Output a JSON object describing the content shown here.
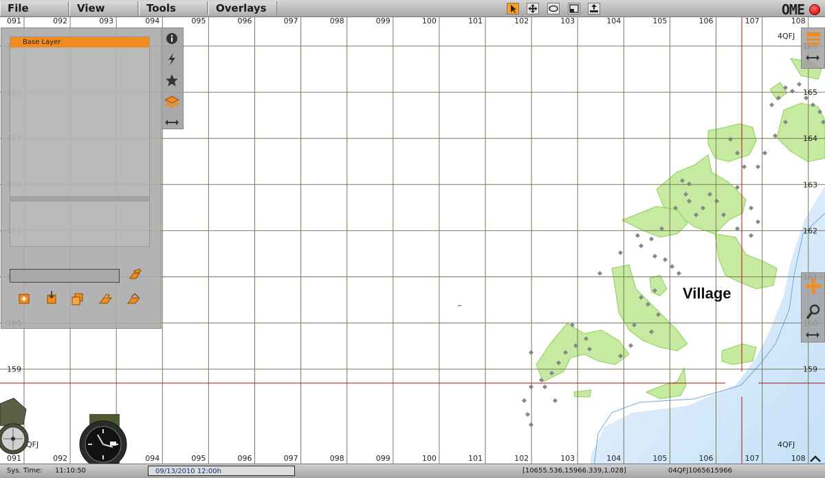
{
  "menu": {
    "items": [
      "File",
      "View",
      "Tools",
      "Overlays"
    ]
  },
  "toolbar": {
    "tools": [
      {
        "name": "pointer-tool",
        "icon": "cursor-arrow-icon",
        "active": true
      },
      {
        "name": "pan-tool",
        "icon": "move-arrows-icon",
        "active": false
      },
      {
        "name": "rotate-tool",
        "icon": "rotate-icon",
        "active": false
      },
      {
        "name": "zoom-box-tool",
        "icon": "zoom-box-icon",
        "active": false
      },
      {
        "name": "export-tool",
        "icon": "upload-icon",
        "active": false
      }
    ],
    "brand": "OME"
  },
  "grid": {
    "columns": [
      "091",
      "092",
      "093",
      "094",
      "095",
      "096",
      "097",
      "098",
      "099",
      "100",
      "101",
      "102",
      "103",
      "104",
      "105",
      "106",
      "107",
      "108"
    ],
    "rows": [
      "166",
      "165",
      "164",
      "163",
      "162",
      "161",
      "160",
      "159"
    ],
    "zone": "4QFJ"
  },
  "map": {
    "place_label": "Village"
  },
  "layers_panel": {
    "header": "Base Layer"
  },
  "side_tabs": [
    "info-icon",
    "lightning-icon",
    "star-icon",
    "layers-icon",
    "collapse-arrows-icon"
  ],
  "statusbar": {
    "time_label": "Sys. Time:",
    "time_value": "11:10:50",
    "date_value": "09/13/2010 12:00h",
    "coords": "[10655.536,15966.339,1.028]",
    "grid_ref": "04QFJ1065615966"
  },
  "colors": {
    "accent": "#f08c1e",
    "vegetation": "#c6eaa0",
    "water": "#cde6fa",
    "grid_red": "#b01010"
  }
}
